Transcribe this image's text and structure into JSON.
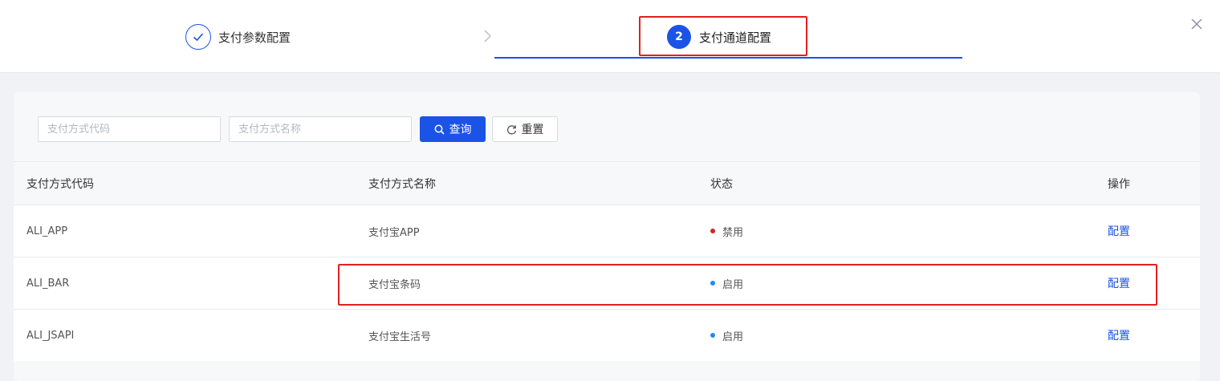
{
  "steps": [
    {
      "label": "支付参数配置",
      "state": "done"
    },
    {
      "number": "2",
      "label": "支付通道配置",
      "state": "active"
    }
  ],
  "filters": {
    "code_placeholder": "支付方式代码",
    "name_placeholder": "支付方式名称",
    "search_label": "查询",
    "reset_label": "重置"
  },
  "table": {
    "headers": [
      "支付方式代码",
      "支付方式名称",
      "状态",
      "操作"
    ],
    "rows": [
      {
        "code": "ALI_APP",
        "name": "支付宝APP",
        "status": "禁用",
        "status_color": "#e02020",
        "action": "配置"
      },
      {
        "code": "ALI_BAR",
        "name": "支付宝条码",
        "status": "启用",
        "status_color": "#1a8cff",
        "action": "配置"
      },
      {
        "code": "ALI_JSAPI",
        "name": "支付宝生活号",
        "status": "启用",
        "status_color": "#1a8cff",
        "action": "配置"
      }
    ]
  },
  "colors": {
    "primary": "#1a53e6",
    "highlight": "#e02020"
  }
}
